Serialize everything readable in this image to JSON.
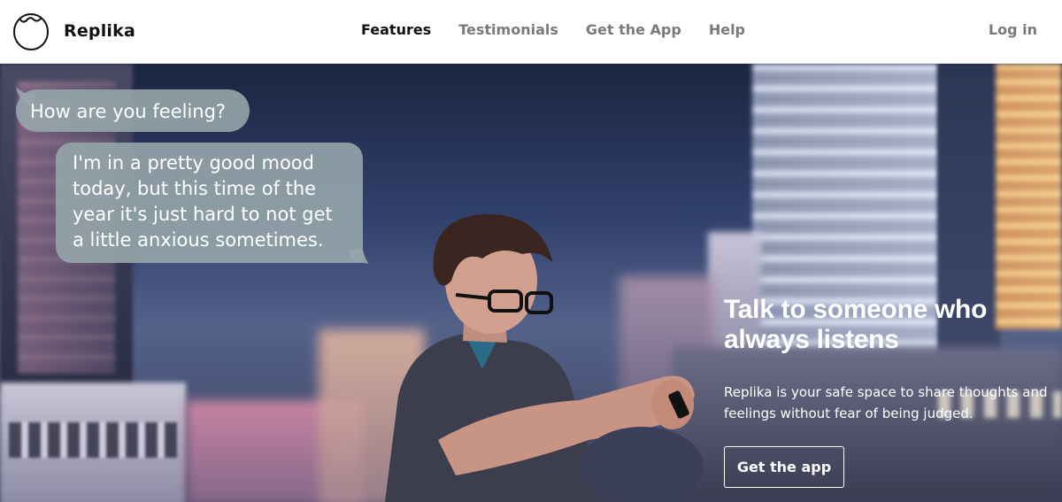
{
  "header": {
    "brand": "Replika",
    "logo_icon": "egg-logo-icon",
    "nav": [
      {
        "label": "Features",
        "active": true
      },
      {
        "label": "Testimonials",
        "active": false
      },
      {
        "label": "Get the App",
        "active": false
      },
      {
        "label": "Help",
        "active": false
      }
    ],
    "login_label": "Log in"
  },
  "chat": {
    "question": "How are you feeling?",
    "answer": "I'm in a pretty good mood today, but this time of the year it's just hard to not get a little anxious sometimes."
  },
  "hero": {
    "title": "Talk to someone who always listens",
    "subtitle": "Replika is your safe space to share thoughts and feelings without fear of being judged.",
    "cta_label": "Get the app"
  },
  "colors": {
    "bubble": "#96a5aa",
    "nav_active": "#111111",
    "nav_inactive": "#7a7a7a"
  }
}
